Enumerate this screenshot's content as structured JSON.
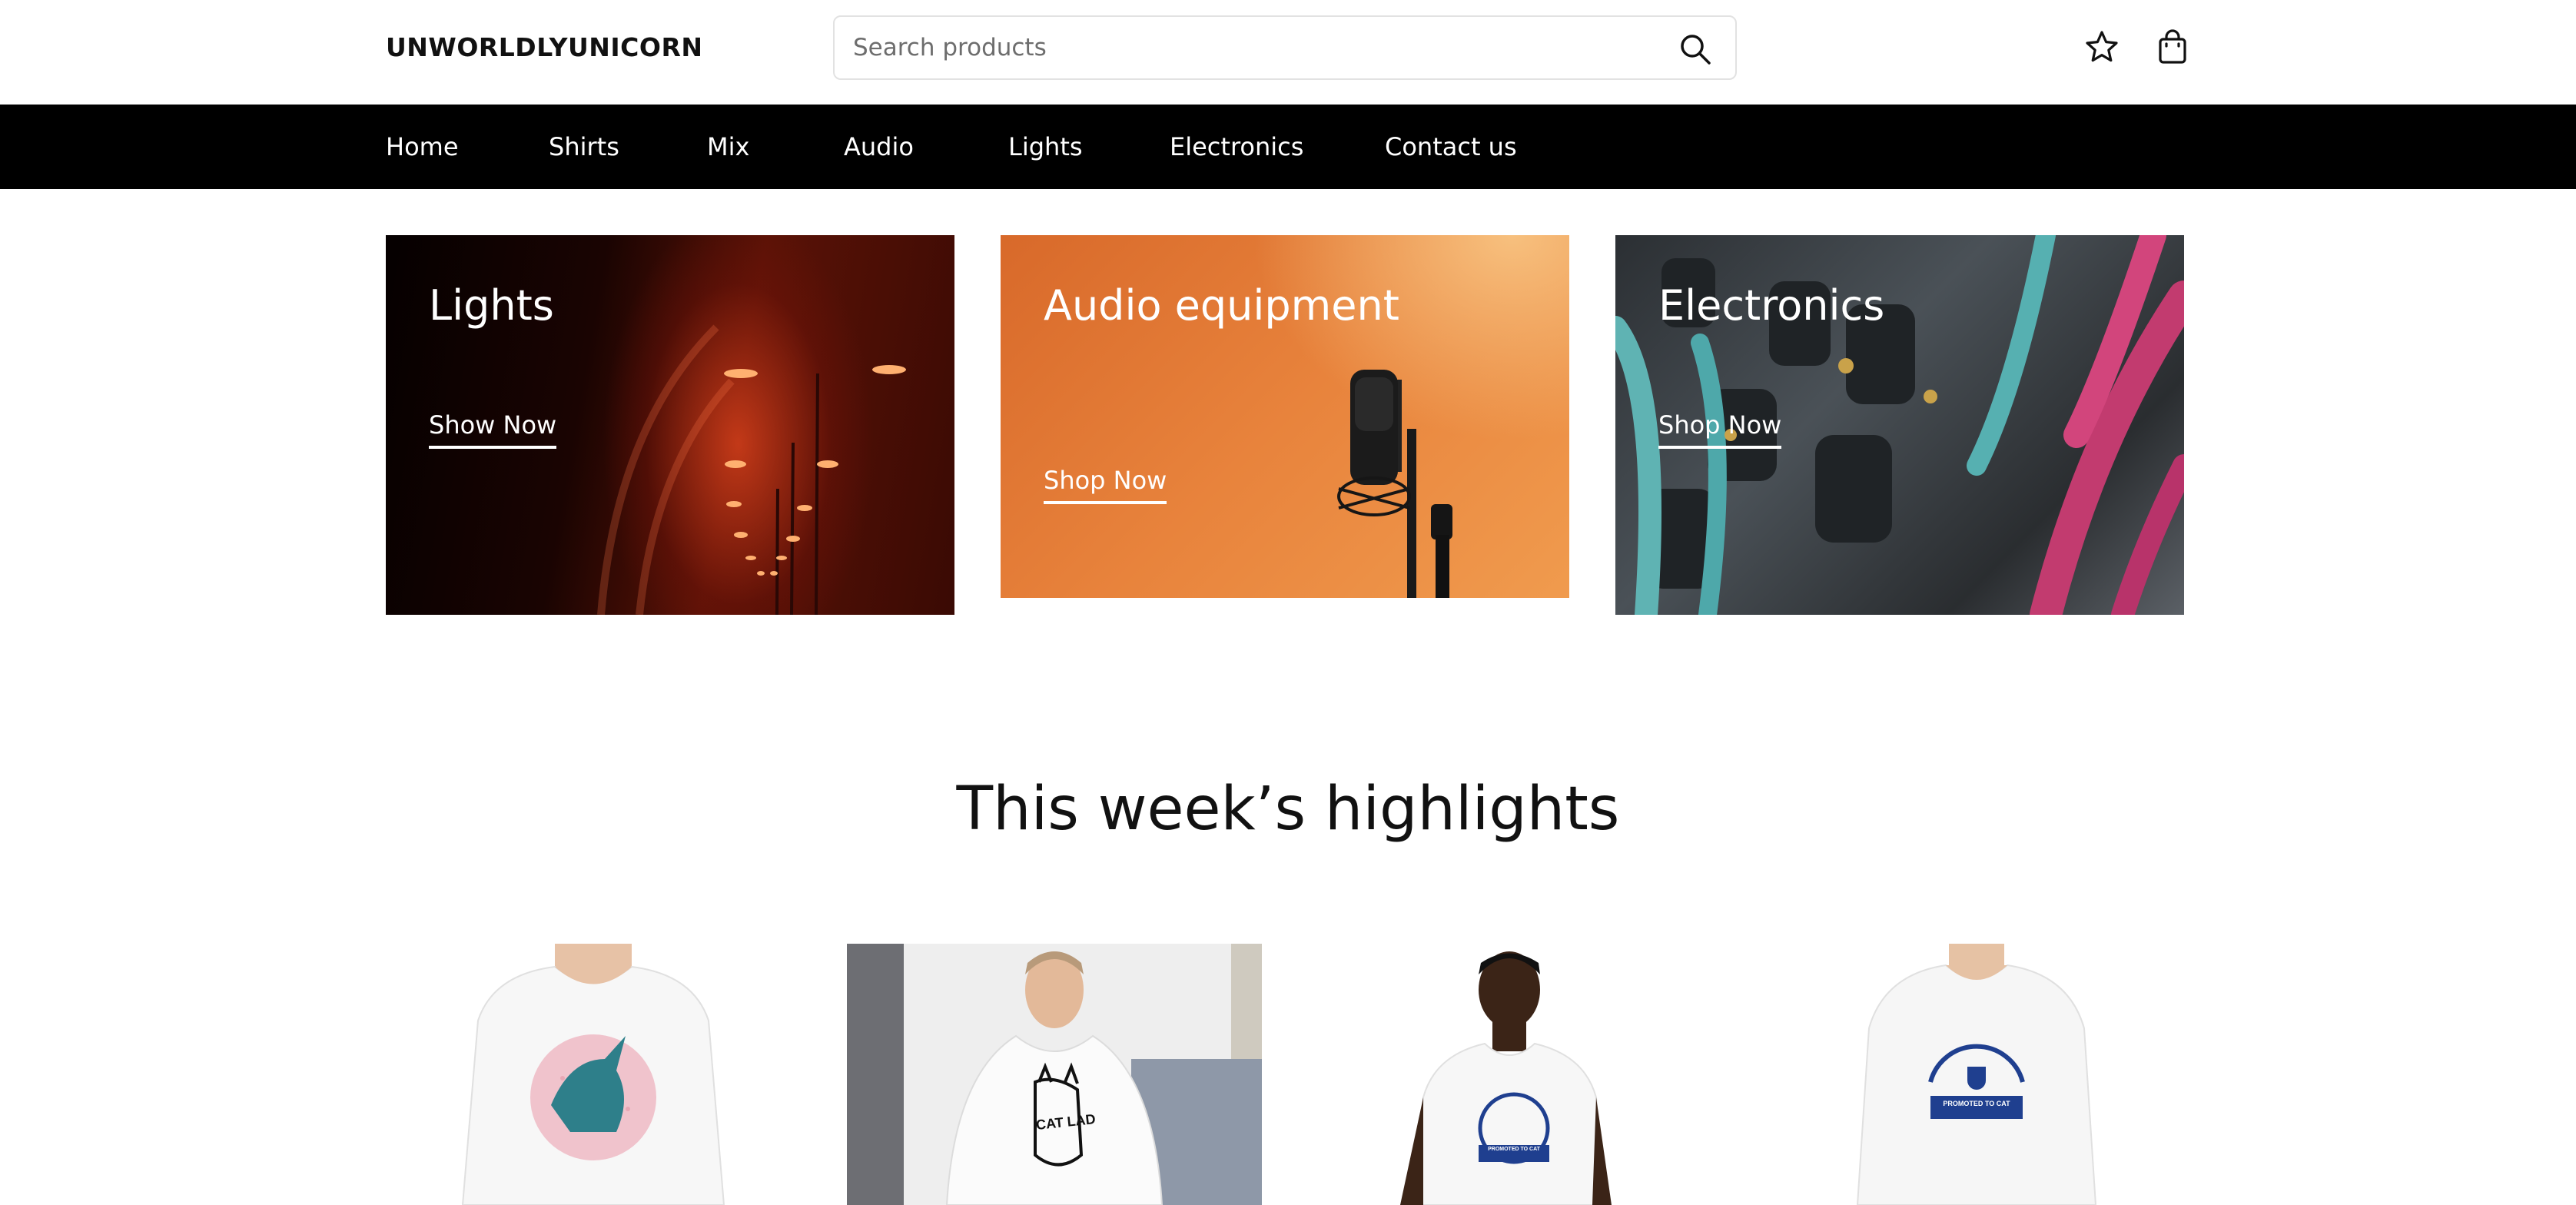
{
  "header": {
    "logo": "UNWORLDLYUNICORN",
    "search_placeholder": "Search products",
    "icons": [
      "search-icon",
      "star-icon",
      "shopping-bag-icon"
    ]
  },
  "nav": {
    "items": [
      {
        "label": "Home"
      },
      {
        "label": "Shirts"
      },
      {
        "label": "Mix"
      },
      {
        "label": "Audio"
      },
      {
        "label": "Lights"
      },
      {
        "label": "Electronics"
      },
      {
        "label": "Contact us"
      }
    ]
  },
  "banners": [
    {
      "title": "Lights",
      "link": "Show Now"
    },
    {
      "title": "Audio equipment",
      "link": "Shop Now"
    },
    {
      "title": "Electronics",
      "link": "Shop Now"
    }
  ],
  "highlights": {
    "title": "This week’s highlights",
    "products": [
      {
        "print_text": ""
      },
      {
        "print_text": "CAT LAD"
      },
      {
        "print_text": "PROMOTED TO CAT"
      },
      {
        "print_text": "PROMOTED TO CAT"
      }
    ]
  },
  "colors": {
    "nav_background": "#000000",
    "print_navy": "#1f3f8f",
    "unicorn_pink": "#e8a7b4",
    "unicorn_teal": "#2e7f8a"
  }
}
